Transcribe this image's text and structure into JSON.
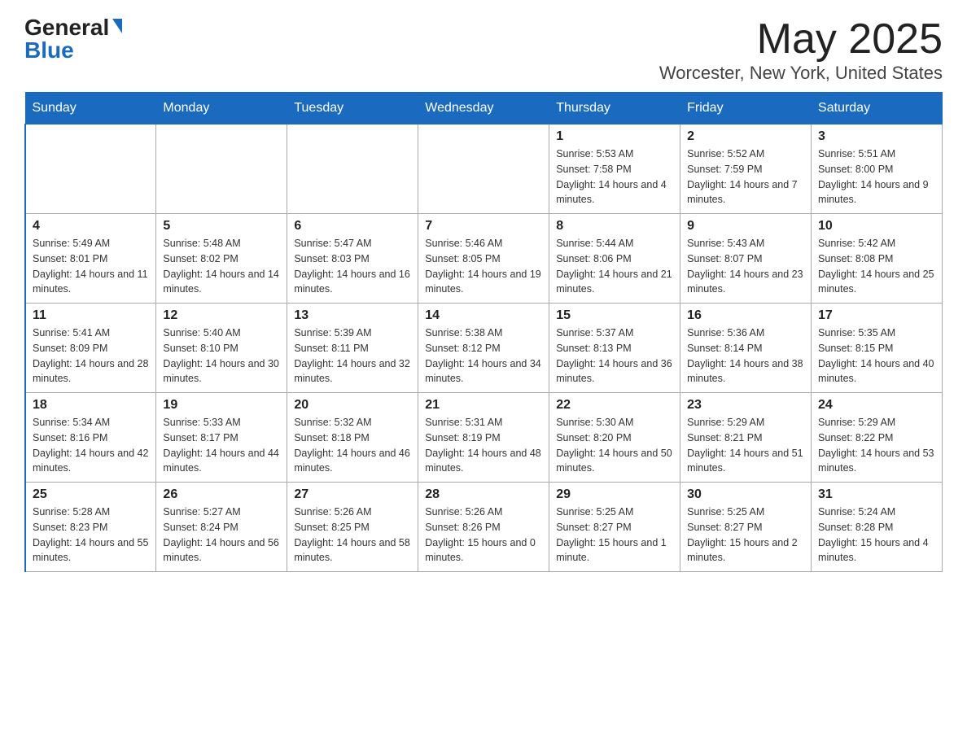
{
  "header": {
    "logo_general": "General",
    "logo_blue": "Blue",
    "month_title": "May 2025",
    "location": "Worcester, New York, United States"
  },
  "days_of_week": [
    "Sunday",
    "Monday",
    "Tuesday",
    "Wednesday",
    "Thursday",
    "Friday",
    "Saturday"
  ],
  "weeks": [
    [
      {
        "day": "",
        "info": ""
      },
      {
        "day": "",
        "info": ""
      },
      {
        "day": "",
        "info": ""
      },
      {
        "day": "",
        "info": ""
      },
      {
        "day": "1",
        "info": "Sunrise: 5:53 AM\nSunset: 7:58 PM\nDaylight: 14 hours and 4 minutes."
      },
      {
        "day": "2",
        "info": "Sunrise: 5:52 AM\nSunset: 7:59 PM\nDaylight: 14 hours and 7 minutes."
      },
      {
        "day": "3",
        "info": "Sunrise: 5:51 AM\nSunset: 8:00 PM\nDaylight: 14 hours and 9 minutes."
      }
    ],
    [
      {
        "day": "4",
        "info": "Sunrise: 5:49 AM\nSunset: 8:01 PM\nDaylight: 14 hours and 11 minutes."
      },
      {
        "day": "5",
        "info": "Sunrise: 5:48 AM\nSunset: 8:02 PM\nDaylight: 14 hours and 14 minutes."
      },
      {
        "day": "6",
        "info": "Sunrise: 5:47 AM\nSunset: 8:03 PM\nDaylight: 14 hours and 16 minutes."
      },
      {
        "day": "7",
        "info": "Sunrise: 5:46 AM\nSunset: 8:05 PM\nDaylight: 14 hours and 19 minutes."
      },
      {
        "day": "8",
        "info": "Sunrise: 5:44 AM\nSunset: 8:06 PM\nDaylight: 14 hours and 21 minutes."
      },
      {
        "day": "9",
        "info": "Sunrise: 5:43 AM\nSunset: 8:07 PM\nDaylight: 14 hours and 23 minutes."
      },
      {
        "day": "10",
        "info": "Sunrise: 5:42 AM\nSunset: 8:08 PM\nDaylight: 14 hours and 25 minutes."
      }
    ],
    [
      {
        "day": "11",
        "info": "Sunrise: 5:41 AM\nSunset: 8:09 PM\nDaylight: 14 hours and 28 minutes."
      },
      {
        "day": "12",
        "info": "Sunrise: 5:40 AM\nSunset: 8:10 PM\nDaylight: 14 hours and 30 minutes."
      },
      {
        "day": "13",
        "info": "Sunrise: 5:39 AM\nSunset: 8:11 PM\nDaylight: 14 hours and 32 minutes."
      },
      {
        "day": "14",
        "info": "Sunrise: 5:38 AM\nSunset: 8:12 PM\nDaylight: 14 hours and 34 minutes."
      },
      {
        "day": "15",
        "info": "Sunrise: 5:37 AM\nSunset: 8:13 PM\nDaylight: 14 hours and 36 minutes."
      },
      {
        "day": "16",
        "info": "Sunrise: 5:36 AM\nSunset: 8:14 PM\nDaylight: 14 hours and 38 minutes."
      },
      {
        "day": "17",
        "info": "Sunrise: 5:35 AM\nSunset: 8:15 PM\nDaylight: 14 hours and 40 minutes."
      }
    ],
    [
      {
        "day": "18",
        "info": "Sunrise: 5:34 AM\nSunset: 8:16 PM\nDaylight: 14 hours and 42 minutes."
      },
      {
        "day": "19",
        "info": "Sunrise: 5:33 AM\nSunset: 8:17 PM\nDaylight: 14 hours and 44 minutes."
      },
      {
        "day": "20",
        "info": "Sunrise: 5:32 AM\nSunset: 8:18 PM\nDaylight: 14 hours and 46 minutes."
      },
      {
        "day": "21",
        "info": "Sunrise: 5:31 AM\nSunset: 8:19 PM\nDaylight: 14 hours and 48 minutes."
      },
      {
        "day": "22",
        "info": "Sunrise: 5:30 AM\nSunset: 8:20 PM\nDaylight: 14 hours and 50 minutes."
      },
      {
        "day": "23",
        "info": "Sunrise: 5:29 AM\nSunset: 8:21 PM\nDaylight: 14 hours and 51 minutes."
      },
      {
        "day": "24",
        "info": "Sunrise: 5:29 AM\nSunset: 8:22 PM\nDaylight: 14 hours and 53 minutes."
      }
    ],
    [
      {
        "day": "25",
        "info": "Sunrise: 5:28 AM\nSunset: 8:23 PM\nDaylight: 14 hours and 55 minutes."
      },
      {
        "day": "26",
        "info": "Sunrise: 5:27 AM\nSunset: 8:24 PM\nDaylight: 14 hours and 56 minutes."
      },
      {
        "day": "27",
        "info": "Sunrise: 5:26 AM\nSunset: 8:25 PM\nDaylight: 14 hours and 58 minutes."
      },
      {
        "day": "28",
        "info": "Sunrise: 5:26 AM\nSunset: 8:26 PM\nDaylight: 15 hours and 0 minutes."
      },
      {
        "day": "29",
        "info": "Sunrise: 5:25 AM\nSunset: 8:27 PM\nDaylight: 15 hours and 1 minute."
      },
      {
        "day": "30",
        "info": "Sunrise: 5:25 AM\nSunset: 8:27 PM\nDaylight: 15 hours and 2 minutes."
      },
      {
        "day": "31",
        "info": "Sunrise: 5:24 AM\nSunset: 8:28 PM\nDaylight: 15 hours and 4 minutes."
      }
    ]
  ]
}
